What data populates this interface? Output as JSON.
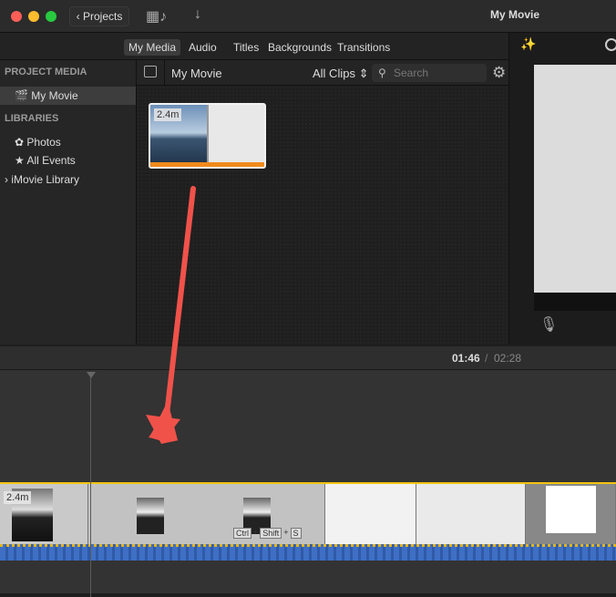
{
  "titlebar": {
    "back_label": "Projects",
    "title": "My Movie"
  },
  "tabs": [
    "My Media",
    "Audio",
    "Titles",
    "Backgrounds",
    "Transitions"
  ],
  "sidebar": {
    "project_media_header": "PROJECT MEDIA",
    "project_item": "My Movie",
    "libraries_header": "LIBRARIES",
    "items": [
      "Photos",
      "All Events",
      "iMovie Library"
    ]
  },
  "browser": {
    "title": "My Movie",
    "filter": "All Clips",
    "search_placeholder": "Search",
    "clip_duration": "2.4m"
  },
  "timeline": {
    "current_time": "01:46",
    "separator": "/",
    "total_time": "02:28",
    "clip_duration": "2.4m",
    "keys": [
      "Ctrl",
      "+",
      "Shift",
      "+",
      "S"
    ]
  },
  "colors": {
    "accent_yellow": "#f1c40f",
    "audio_blue": "#3e6fc4",
    "arrow_red": "#f0524a"
  }
}
